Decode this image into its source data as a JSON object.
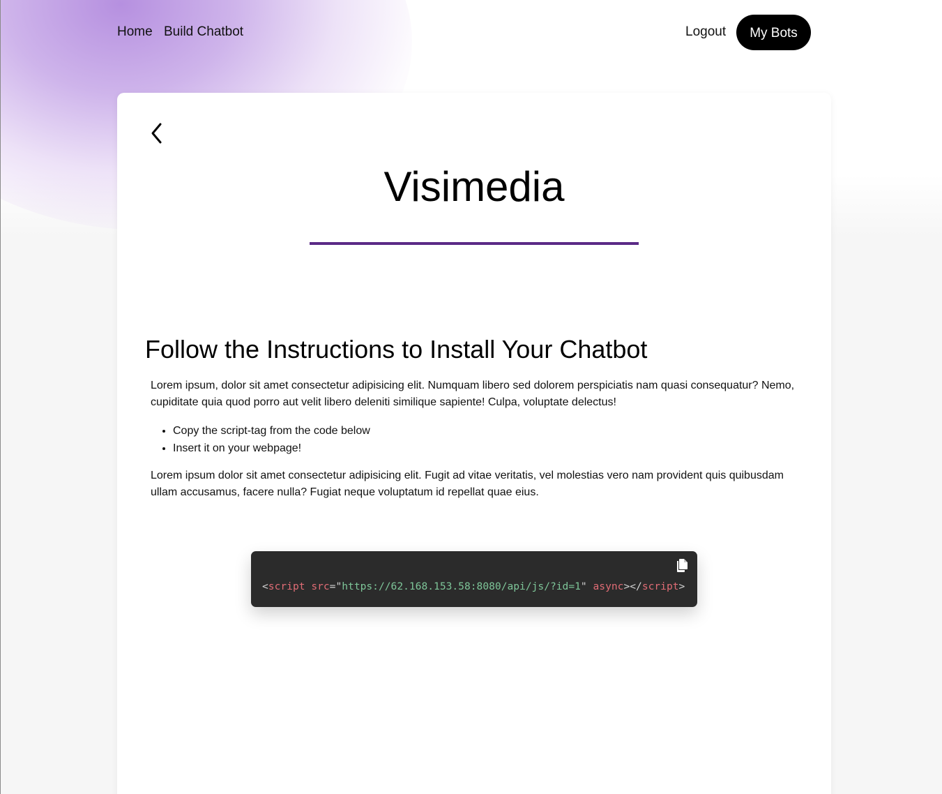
{
  "colors": {
    "accent_underline": "#5b2a86",
    "nav_button_bg": "#000000",
    "code_bg": "#2b2b2b",
    "code_tag": "#e06c75",
    "code_string": "#7ec699"
  },
  "nav": {
    "home": "Home",
    "build": "Build Chatbot",
    "logout": "Logout",
    "my_bots": "My Bots"
  },
  "card": {
    "back_icon": "chevron-left-icon",
    "title": "Visimedia",
    "heading": "Follow the Instructions to Install Your Chatbot",
    "para1": "Lorem ipsum, dolor sit amet consectetur adipisicing elit. Numquam libero sed dolorem perspiciatis nam quasi consequatur? Nemo, cupiditate quia quod porro aut velit libero deleniti similique sapiente! Culpa, voluptate delectus!",
    "steps": [
      "Copy the script-tag from the code below",
      "Insert it on your webpage!"
    ],
    "para2": "Lorem ipsum dolor sit amet consectetur adipisicing elit. Fugit ad vitae veritatis, vel molestias vero nam provident quis quibusdam ullam accusamus, facere nulla? Fugiat neque voluptatum id repellat quae eius."
  },
  "code": {
    "copy_icon": "copy-icon",
    "open_bracket": "<",
    "tag": "script",
    "attr_src": "src",
    "eq_quote": "=\"",
    "src_value": "https://62.168.153.58:8080/api/js/?id=1",
    "close_quote": "\"",
    "attr_async": "async",
    "mid": "></",
    "close_tag": "script",
    "end_bracket": ">"
  }
}
